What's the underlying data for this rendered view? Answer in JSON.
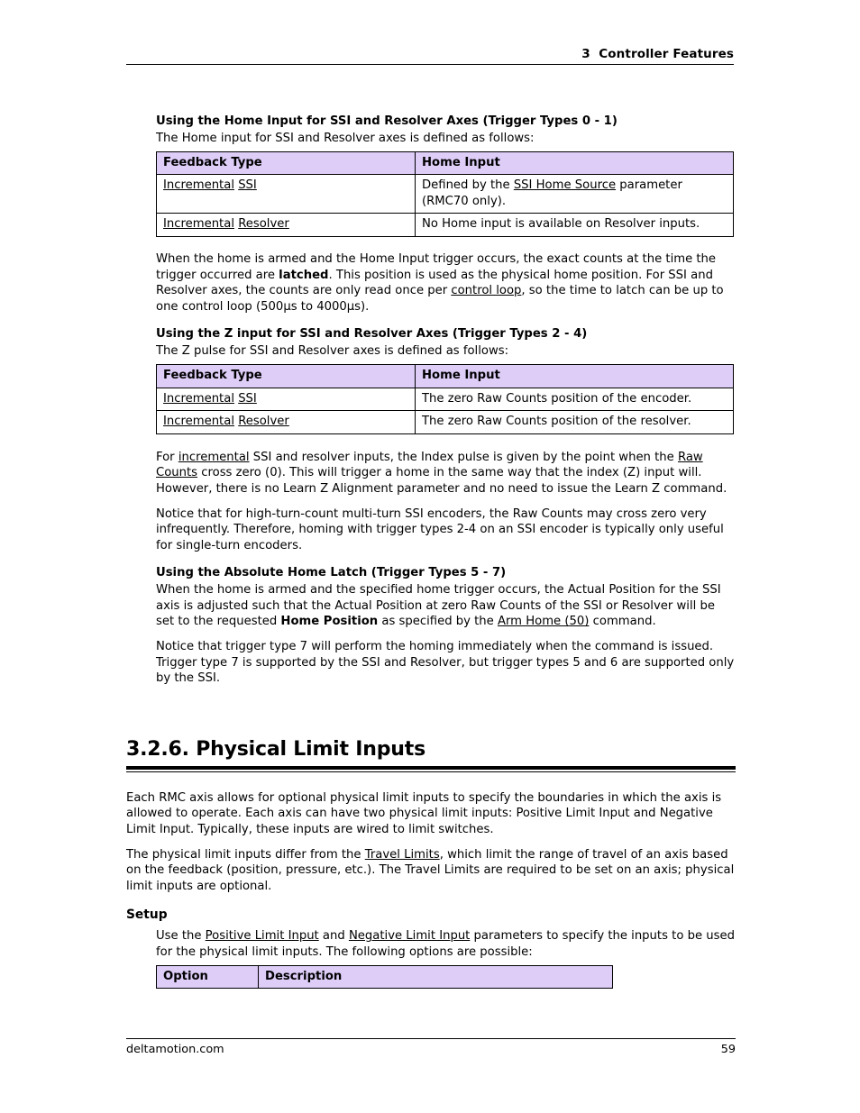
{
  "header": {
    "chapter_number": "3",
    "chapter_title": "Controller Features",
    "text": "3  Controller Features"
  },
  "colors": {
    "table_header_bg": "#DDCDF7",
    "text": "#000000",
    "rule": "#000000"
  },
  "sections": {
    "home_input": {
      "heading": "Using the Home Input for SSI and Resolver Axes (Trigger Types 0 - 1)",
      "lead": "The Home input for SSI and Resolver axes is defined as follows:",
      "table": {
        "headers": [
          "Feedback Type",
          "Home Input"
        ],
        "rows": [
          {
            "feedback_prefix": "Incremental",
            "feedback_suffix": "SSI",
            "home_input_pre": "Defined by the ",
            "home_input_link": "SSI Home Source",
            "home_input_post": " parameter (RMC70 only)."
          },
          {
            "feedback_prefix": "Incremental",
            "feedback_suffix": "Resolver",
            "home_input_pre": "No Home input is available on Resolver inputs.",
            "home_input_link": "",
            "home_input_post": ""
          }
        ]
      },
      "paragraph_1_a": "When the home is armed and the Home Input trigger occurs, the exact counts at the time the trigger occurred are ",
      "paragraph_1_bold": "latched",
      "paragraph_1_b": ". This position is used as the physical home position. For SSI and Resolver axes, the counts are only read once per ",
      "paragraph_1_link": "control loop",
      "paragraph_1_c": ", so the time to latch can be up to one control loop (500µs to 4000µs)."
    },
    "z_input": {
      "heading": "Using the Z input for SSI and Resolver Axes (Trigger Types 2 - 4)",
      "lead": "The Z pulse for SSI and Resolver axes is defined as follows:",
      "table": {
        "headers": [
          "Feedback Type",
          "Home Input"
        ],
        "rows": [
          {
            "feedback_prefix": "Incremental",
            "feedback_suffix": "SSI",
            "home_input": "The zero Raw Counts position of the encoder."
          },
          {
            "feedback_prefix": "Incremental",
            "feedback_suffix": "Resolver",
            "home_input": "The zero Raw Counts position of the resolver."
          }
        ]
      },
      "paragraph_1_a": "For ",
      "paragraph_1_link1": "incremental",
      "paragraph_1_b": " SSI and resolver inputs, the Index pulse is given by the point when the ",
      "paragraph_1_link2": "Raw Counts",
      "paragraph_1_c": " cross zero (0). This will trigger a home in the same way that the index (Z) input will. However, there is no Learn Z Alignment parameter and no need to issue the Learn Z command.",
      "paragraph_2": "Notice that for high-turn-count multi-turn SSI encoders, the Raw Counts may cross zero very infrequently. Therefore, homing with trigger types 2-4 on an SSI encoder is typically only useful for single-turn encoders."
    },
    "absolute_home_latch": {
      "heading": "Using the Absolute Home Latch (Trigger Types 5 - 7)",
      "paragraph_1_a": "When the home is armed and the specified home trigger occurs, the Actual Position for the SSI axis is adjusted such that the Actual Position at zero Raw Counts of the SSI or Resolver will be set to the requested ",
      "paragraph_1_bold": "Home Position",
      "paragraph_1_b": " as specified by the ",
      "paragraph_1_link": "Arm Home (50)",
      "paragraph_1_c": " command.",
      "paragraph_2": "Notice that trigger type 7 will perform the homing immediately when the command is issued. Trigger type 7 is supported by the SSI and Resolver, but trigger types 5 and 6 are supported only by the SSI."
    },
    "physical_limit_inputs": {
      "number": "3.2.6.",
      "title": "3.2.6. Physical Limit Inputs",
      "paragraph_1": "Each RMC axis allows for optional physical limit inputs to specify the boundaries in which the axis is allowed to operate. Each axis can have two physical limit inputs: Positive Limit Input and Negative Limit Input. Typically, these inputs are wired to limit switches.",
      "paragraph_2_a": "The physical limit inputs differ from the ",
      "paragraph_2_link": "Travel Limits",
      "paragraph_2_b": ", which limit the range of travel of an axis based on the feedback (position, pressure, etc.). The Travel Limits are required to be set on an axis; physical limit inputs are optional.",
      "setup": {
        "heading": "Setup",
        "paragraph_a": "Use the ",
        "paragraph_link1": "Positive Limit Input",
        "paragraph_b": " and ",
        "paragraph_link2": "Negative Limit Input",
        "paragraph_c": " parameters to specify the inputs to be used for the physical limit inputs. The following options are possible:",
        "table": {
          "headers": [
            "Option",
            "Description"
          ]
        }
      }
    }
  },
  "footer": {
    "site": "deltamotion.com",
    "page_number": "59"
  }
}
